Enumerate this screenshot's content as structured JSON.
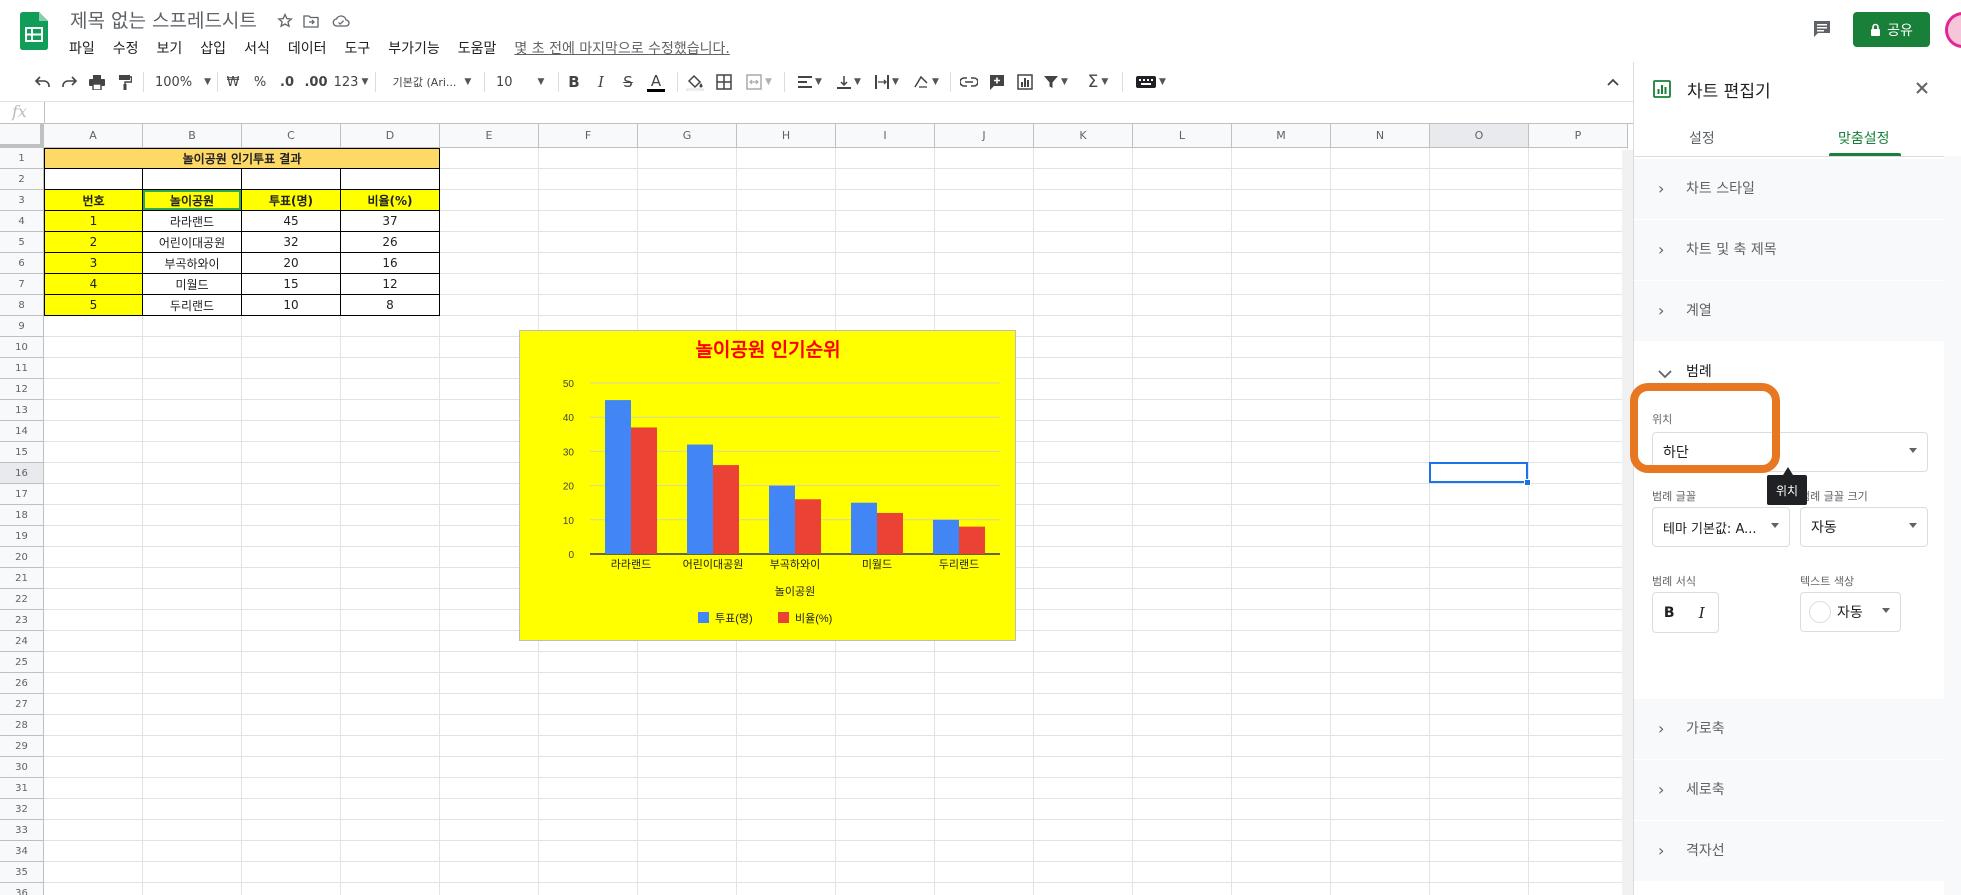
{
  "header": {
    "doc_title": "제목 없는 스프레드시트",
    "menu": [
      "파일",
      "수정",
      "보기",
      "삽입",
      "서식",
      "데이터",
      "도구",
      "부가기능",
      "도움말"
    ],
    "last_edit": "몇 초 전에 마지막으로 수정했습니다.",
    "share_label": "공유"
  },
  "toolbar": {
    "zoom": "100%",
    "currency": "₩",
    "percent": "%",
    "dec_less": ".0",
    "dec_more": ".00",
    "format_more": "123",
    "font": "기본값 (Ari...",
    "font_size": "10"
  },
  "formula_bar": {
    "fx": "fx"
  },
  "sheet": {
    "columns": [
      "A",
      "B",
      "C",
      "D",
      "E",
      "F",
      "G",
      "H",
      "I",
      "J",
      "K",
      "L",
      "M",
      "N",
      "O",
      "P"
    ],
    "rows": [
      "1",
      "2",
      "3",
      "4",
      "5",
      "6",
      "7",
      "8",
      "9",
      "10",
      "11",
      "12",
      "13",
      "14",
      "15",
      "16",
      "17",
      "18",
      "19",
      "20",
      "21",
      "22",
      "23",
      "24",
      "25",
      "26",
      "27",
      "28",
      "29",
      "30",
      "31",
      "32",
      "33",
      "34",
      "35",
      "36"
    ],
    "table_title": "놀이공원 인기투표 결과",
    "table_headers": [
      "번호",
      "놀이공원",
      "투표(명)",
      "비율(%)"
    ],
    "table_rows": [
      [
        "1",
        "라라랜드",
        "45",
        "37"
      ],
      [
        "2",
        "어린이대공원",
        "32",
        "26"
      ],
      [
        "3",
        "부곡하와이",
        "20",
        "16"
      ],
      [
        "4",
        "미월드",
        "15",
        "12"
      ],
      [
        "5",
        "두리랜드",
        "10",
        "8"
      ]
    ]
  },
  "chart_data": {
    "type": "bar",
    "title": "놀이공원 인기순위",
    "xlabel": "놀이공원",
    "ylabel": "",
    "categories": [
      "라라랜드",
      "어린이대공원",
      "부곡하와이",
      "미월드",
      "두리랜드"
    ],
    "series": [
      {
        "name": "투표(명)",
        "values": [
          45,
          32,
          20,
          15,
          10
        ],
        "color": "#4285f4"
      },
      {
        "name": "비율(%)",
        "values": [
          37,
          26,
          16,
          12,
          8
        ],
        "color": "#ea4335"
      }
    ],
    "ylim": [
      0,
      50
    ],
    "yticks": [
      "0",
      "10",
      "20",
      "30",
      "40",
      "50"
    ],
    "grid": true,
    "legend": "bottom",
    "background": "#ffff00",
    "title_color": "#ff0000"
  },
  "panel": {
    "title": "차트 편집기",
    "tabs": [
      "설정",
      "맞춤설정"
    ],
    "sections": [
      "차트 스타일",
      "차트 및 축 제목",
      "계열",
      "범례",
      "가로축",
      "세로축",
      "격자선"
    ],
    "legend": {
      "position_label": "위치",
      "position_value": "하단",
      "tooltip": "위치",
      "font_label": "범례 글꼴",
      "font_value": "테마 기본값: A...",
      "font_size_label": "범례 글꼴 크기",
      "font_size_value": "자동",
      "format_label": "범례 서식",
      "bold": "B",
      "italic": "I",
      "text_color_label": "텍스트 색상",
      "text_color_value": "자동"
    }
  },
  "colors": {
    "accent": "#188038",
    "selection": "#1a73e8",
    "highlight": "#e87722",
    "title_fill": "#ffd966",
    "header_fill": "#ffff00"
  }
}
